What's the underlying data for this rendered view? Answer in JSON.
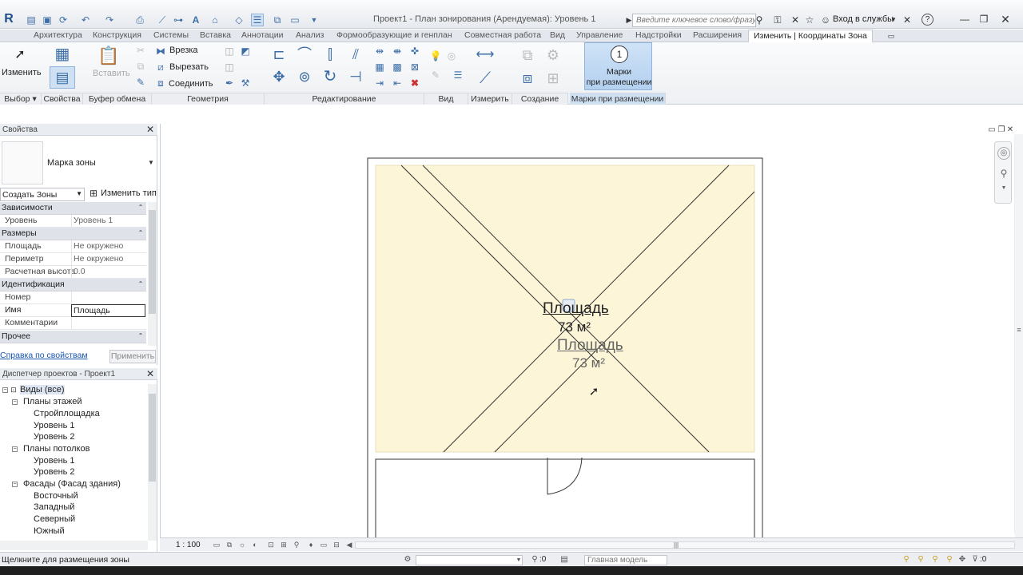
{
  "window": {
    "title": "Проект1 - План зонирования (Арендуемая): Уровень 1",
    "search_placeholder": "Введите ключевое слово/фразу",
    "signin": "Вход в службы"
  },
  "tabs": [
    "Архитектура",
    "Конструкция",
    "Системы",
    "Вставка",
    "Аннотации",
    "Анализ",
    "Формообразующие и генплан",
    "Совместная работа",
    "Вид",
    "Управление",
    "Надстройки",
    "Расширения",
    "Изменить | Координаты Зона"
  ],
  "ribbon": {
    "modify_label": "Изменить",
    "paste_label": "Вставить",
    "cut_label": "Врезка",
    "cutout_label": "Вырезать",
    "join_label": "Соединить",
    "tags_label": "Марки\nпри размещении",
    "groups": [
      "Выбор",
      "Свойства",
      "Буфер обмена",
      "Геометрия",
      "Редактирование",
      "Вид",
      "Измерить",
      "Создание",
      "Марки при размещении"
    ]
  },
  "properties": {
    "title": "Свойства",
    "type_name": "Марка зоны",
    "selector": "Создать Зоны",
    "edit_type": "Изменить тип",
    "categories": {
      "constraints": "Зависимости",
      "dimensions": "Размеры",
      "identity": "Идентификация",
      "other": "Прочее"
    },
    "rows": {
      "level": {
        "k": "Уровень",
        "v": "Уровень 1"
      },
      "area": {
        "k": "Площадь",
        "v": "Не окружено"
      },
      "perimeter": {
        "k": "Периметр",
        "v": "Не окружено"
      },
      "height": {
        "k": "Расчетная высота",
        "v": "0.0"
      },
      "number": {
        "k": "Номер",
        "v": ""
      },
      "name": {
        "k": "Имя",
        "v": "Площадь"
      },
      "comments": {
        "k": "Комментарии",
        "v": ""
      }
    },
    "help_link": "Справка по свойствам",
    "apply": "Применить"
  },
  "browser": {
    "title": "Диспетчер проектов - Проект1",
    "items": [
      "Виды (все)",
      "Планы этажей",
      "Стройплощадка",
      "Уровень 1",
      "Уровень 2",
      "Планы потолков",
      "Уровень 1",
      "Уровень 2",
      "Фасады (Фасад здания)",
      "Восточный",
      "Западный",
      "Северный",
      "Южный"
    ]
  },
  "canvas": {
    "tag1_name": "Площадь",
    "tag1_area": "73 м²",
    "tag2_name": "Площадь",
    "tag2_area": "73 м²"
  },
  "viewbar": {
    "scale": "1 : 100"
  },
  "status": {
    "message": "Щелкните для размещения зоны",
    "workset_value": ":0",
    "model": "Главная модель",
    "filter_value": ":0"
  },
  "colors": {
    "zone_fill": "#fdf5d7",
    "ribbon_active": "#b9d4f1",
    "tab_active": "#ffffff"
  }
}
